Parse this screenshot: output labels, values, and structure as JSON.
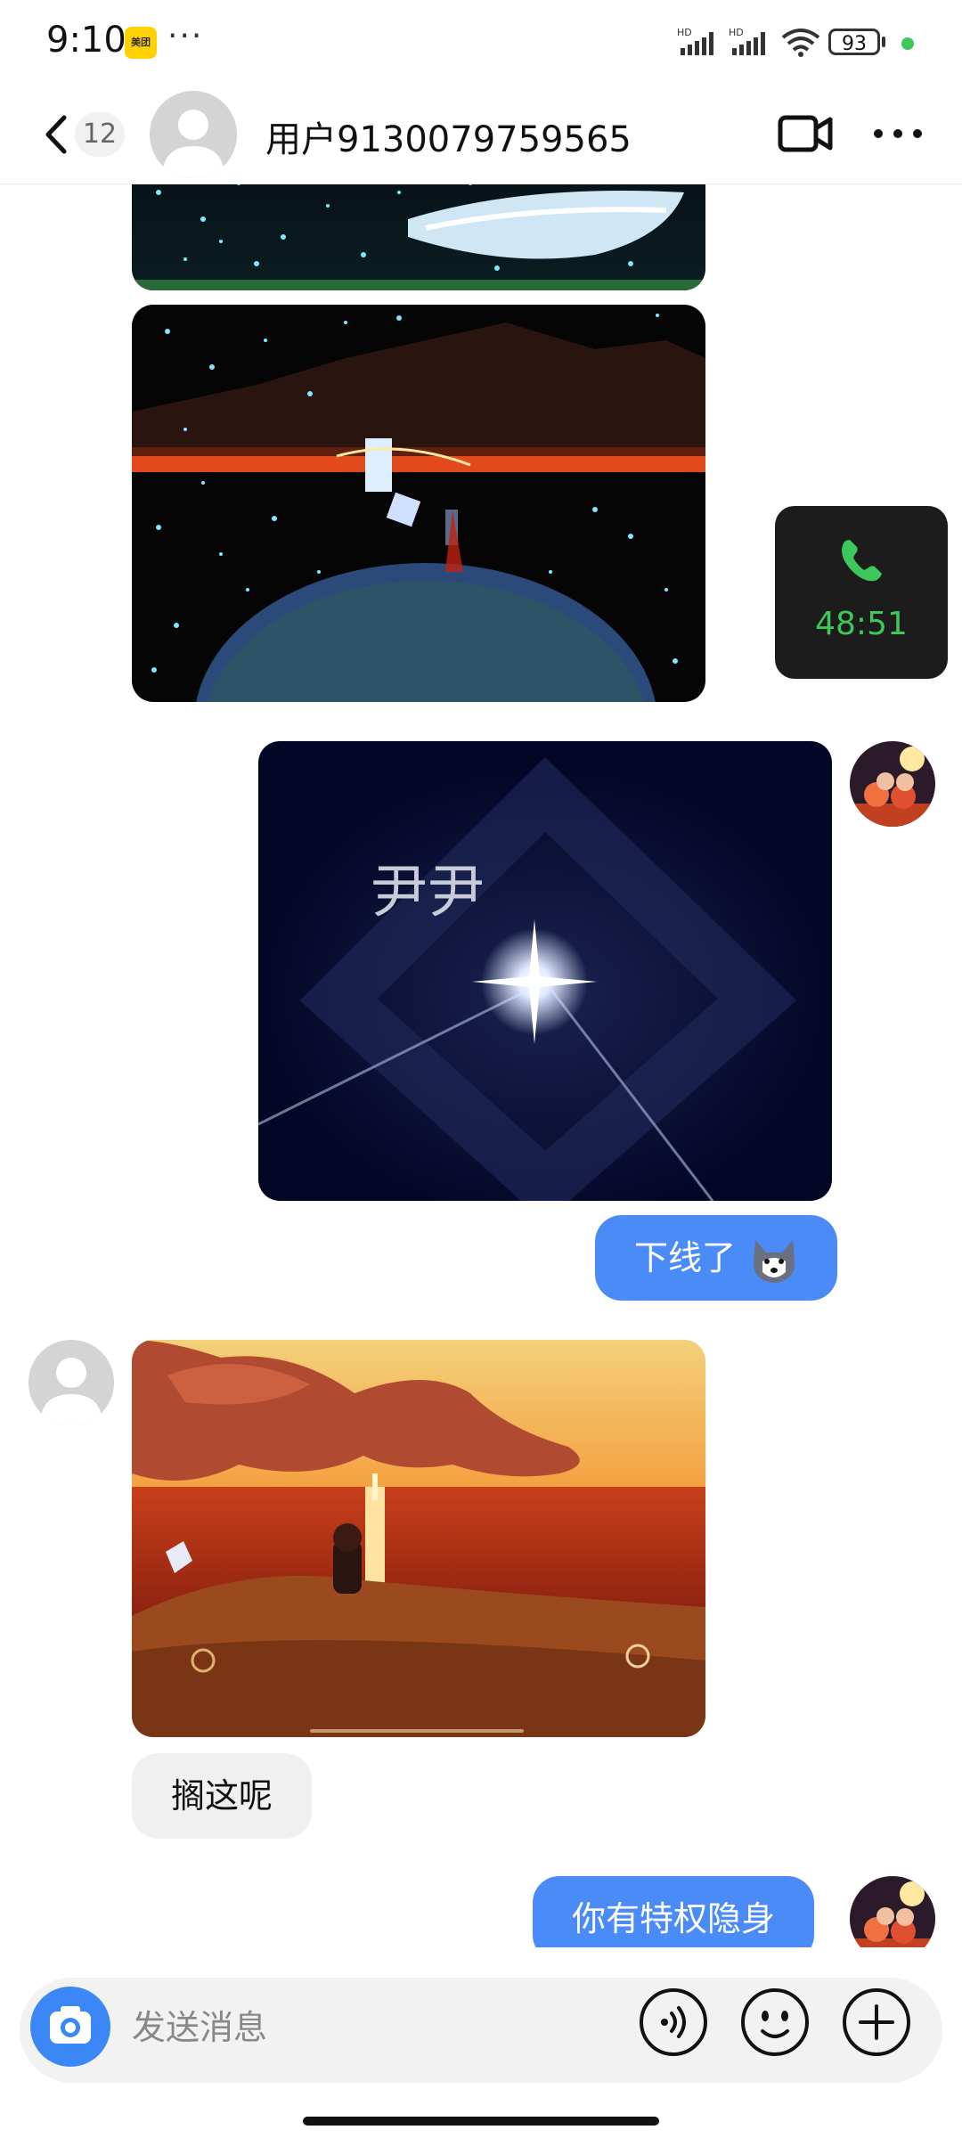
{
  "status_bar": {
    "time": "9:10",
    "app_badge": "美团",
    "more": "···",
    "signal_label": "HD",
    "battery": "93"
  },
  "header": {
    "back_count": "12",
    "title": "用户9130079759565"
  },
  "call_float": {
    "duration": "48:51"
  },
  "messages": {
    "overlay_text": "尹尹",
    "out_text_1": "下线了",
    "in_text_1": "搁这呢",
    "out_text_2": "你有特权隐身"
  },
  "input": {
    "placeholder": "发送消息"
  },
  "colors": {
    "accent": "#4a8bf7",
    "call_green": "#3cc85a",
    "camera_blue": "#3a87f5"
  }
}
